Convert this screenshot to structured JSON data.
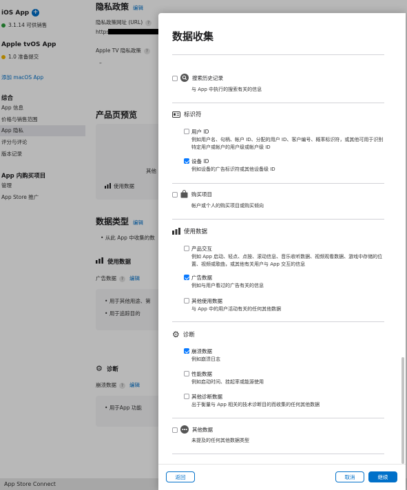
{
  "sidebar": {
    "apps": [
      {
        "name": "iOS App",
        "status": "3.1.14 可供销售",
        "status_color": "#2a9d3a"
      },
      {
        "name": "Apple tvOS App",
        "status": "1.0 准备提交",
        "status_color": "#f0b400"
      }
    ],
    "add_macos": "添加 macOS App",
    "section_general": "综合",
    "general_items": [
      "App 信息",
      "价格与销售范围",
      "App 隐私",
      "评分与评论",
      "版本记录"
    ],
    "section_iap": "App 内购买项目",
    "iap_items": [
      "管理",
      "App Store 推广"
    ]
  },
  "main": {
    "privacy_title": "隐私政策",
    "edit": "编辑",
    "privacy_url_label": "隐私政策网址 (URL)",
    "privacy_url_value": "https",
    "tv_privacy_label": "Apple TV 隐私政策",
    "tv_privacy_value": "–",
    "preview_title": "产品页预览",
    "preview_other": "其他",
    "preview_usage": "使用数据",
    "data_types_title": "数据类型",
    "data_types_bullet": "从此 App 中收集的数",
    "usage_head": "使用数据",
    "ad_data_label": "广告数据",
    "ad_bullets": [
      "用于其他用途、第",
      "用于追踪目的"
    ],
    "diag_head": "诊断",
    "crash_label": "崩溃数据",
    "crash_bullets": [
      "用于App 功能"
    ],
    "help": "?"
  },
  "footer": {
    "text": "App Store Connect"
  },
  "modal": {
    "title": "数据收集",
    "sections": {
      "search": {
        "title": "搜索历史记录",
        "desc": "与 App 中执行的搜索有关的信息"
      },
      "identifiers": {
        "title": "标识符",
        "items": [
          {
            "title": "用户 ID",
            "desc": "例如用户名、句柄、帐户 ID、分配的用户 ID、客户编号、概率标识符，或其他可用于识别特定用户或帐户的用户级或帐户级 ID"
          },
          {
            "title": "设备 ID",
            "desc": "例如设备的广告标识符或其他设备级 ID"
          }
        ]
      },
      "purchases": {
        "title": "购买项目",
        "desc": "帐户或个人的购买项目或购买倾向"
      },
      "usage": {
        "title": "使用数据",
        "items": [
          {
            "title": "产品交互",
            "desc": "例如 App 启动、轻点、点按、滚动信息、音乐收听数据、视频观看数据、游戏中存储的位置、视频或歌曲，或其他有关用户与 App 交互的信息"
          },
          {
            "title": "广告数据",
            "desc": "例如与用户看过的广告有关的信息"
          },
          {
            "title": "其他使用数据",
            "desc": "与 App 中的用户活动有关的任何其他数据"
          }
        ]
      },
      "diagnostics": {
        "title": "诊断",
        "items": [
          {
            "title": "崩溃数据",
            "desc": "例如崩溃日志"
          },
          {
            "title": "性能数据",
            "desc": "例如启动时间、挂起率或能源使用"
          },
          {
            "title": "其他诊断数据",
            "desc": "出于衡量与 App 相关的技术诊断目的而收集的任何其他数据"
          }
        ]
      },
      "other": {
        "title": "其他数据",
        "desc": "未提及的任何其他数据类型"
      }
    },
    "buttons": {
      "back": "返回",
      "cancel": "取消",
      "continue": "继续"
    },
    "colors": {
      "accent": "#0070c9",
      "checkbox_on": "#0a7aff"
    }
  }
}
